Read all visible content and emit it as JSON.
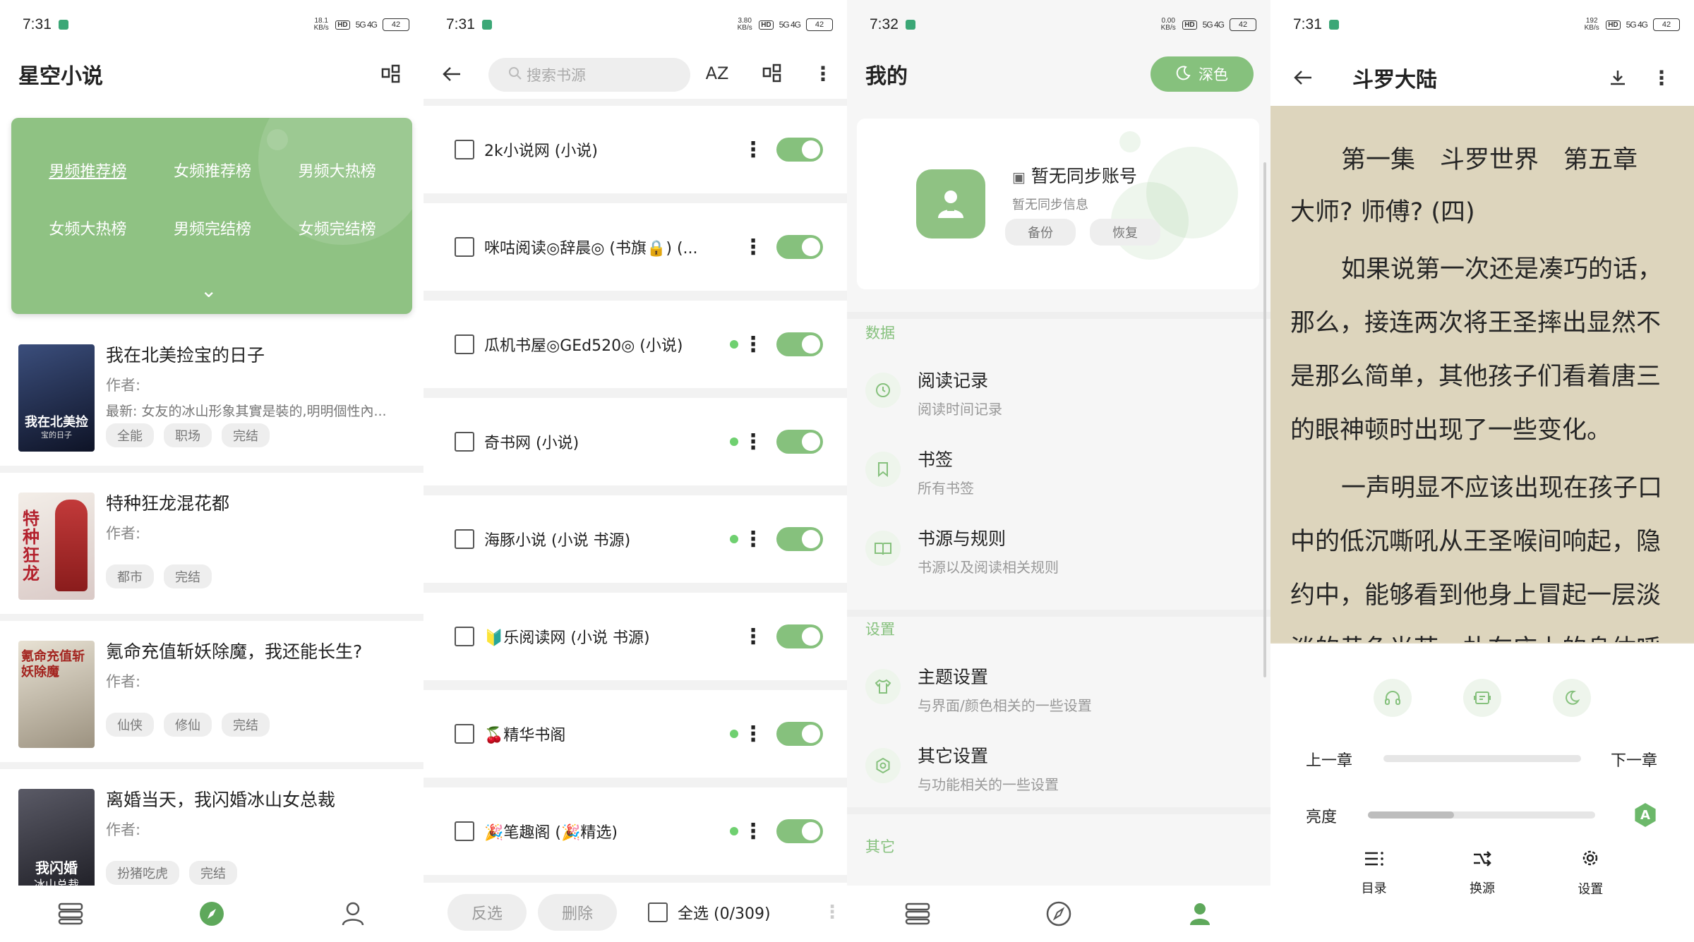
{
  "status_panel1": {
    "time": "7:31",
    "rate_top": "18.1",
    "rate_unit": "KB/s",
    "hd": "HD",
    "net": "5G 4G",
    "battery": "42"
  },
  "status_panel2": {
    "time": "7:31",
    "rate_top": "3.80",
    "rate_unit": "KB/s",
    "hd": "HD",
    "net": "5G 4G",
    "battery": "42"
  },
  "status_panel3": {
    "time": "7:32",
    "rate_top": "0.00",
    "rate_unit": "KB/s",
    "hd": "HD",
    "net": "5G 4G",
    "battery": "42"
  },
  "status_panel4": {
    "time": "7:31",
    "rate_top": "192",
    "rate_unit": "KB/s",
    "hd": "HD",
    "net": "5G 4G",
    "battery": "42"
  },
  "discover": {
    "title": "星空小说",
    "rank_tabs": [
      "男频推荐榜",
      "女频推荐榜",
      "男频大热榜",
      "女频大热榜",
      "男频完结榜",
      "女频完结榜"
    ],
    "books": [
      {
        "title": "我在北美捡宝的日子",
        "author": "作者:",
        "latest": "最新: 女友的冰山形象其實是裝的,明明個性內...",
        "tags": [
          "全能",
          "职场",
          "完结"
        ],
        "cover_text": "我在北美捡",
        "cover_sub": "宝的日子",
        "cover_color": "#1d2a4a"
      },
      {
        "title": "特种狂龙混花都",
        "author": "作者:",
        "latest": "",
        "tags": [
          "都市",
          "完结"
        ],
        "cover_text": "特种狂龙",
        "cover_sub": "",
        "cover_color": "#e9e3e0"
      },
      {
        "title": "氪命充值斩妖除魔，我还能长生?",
        "author": "作者:",
        "latest": "",
        "tags": [
          "仙侠",
          "修仙",
          "完结"
        ],
        "cover_text": "氪命充值斩妖除魔",
        "cover_sub": "",
        "cover_color": "#d8d2c4"
      },
      {
        "title": "离婚当天，我闪婚冰山女总裁",
        "author": "作者:",
        "latest": "",
        "tags": [
          "扮猪吃虎",
          "完结"
        ],
        "cover_text": "我闪婚",
        "cover_sub": "冰山总裁",
        "cover_color": "#3a3a44"
      }
    ]
  },
  "sources": {
    "search_placeholder": "搜索书源",
    "az": "AZ",
    "items": [
      {
        "name": "2k小说网 (小说)",
        "dot": false
      },
      {
        "name": "咪咕阅读◎辞晨◎ (书旗🔒) (...",
        "dot": false
      },
      {
        "name": "瓜机书屋◎GEd520◎ (小说)",
        "dot": true
      },
      {
        "name": "奇书网 (小说)",
        "dot": true
      },
      {
        "name": "海豚小说 (小说 书源)",
        "dot": true
      },
      {
        "name": "🔰乐阅读网 (小说 书源)",
        "dot": false
      },
      {
        "name": "🍒精华书阁",
        "dot": true
      },
      {
        "name": "🎉笔趣阁 (🎉精选)",
        "dot": true
      }
    ],
    "invert_label": "反选",
    "delete_label": "删除",
    "select_all_label": "全选 (0/309)"
  },
  "mine": {
    "title": "我的",
    "dark_label": "深色",
    "account_name": "暂无同步账号",
    "account_sub": "暂无同步信息",
    "backup_label": "备份",
    "restore_label": "恢复",
    "section_data": "数据",
    "section_settings": "设置",
    "section_other": "其它",
    "items": [
      {
        "title": "阅读记录",
        "sub": "阅读时间记录"
      },
      {
        "title": "书签",
        "sub": "所有书签"
      },
      {
        "title": "书源与规则",
        "sub": "书源以及阅读相关规则"
      },
      {
        "title": "主题设置",
        "sub": "与界面/颜色相关的一些设置"
      },
      {
        "title": "其它设置",
        "sub": "与功能相关的一些设置"
      }
    ]
  },
  "reader": {
    "title": "斗罗大陆",
    "chapter": "第一集　斗罗世界　第五章　大师? 师傅? (四)",
    "para1": "如果说第一次还是凑巧的话，那么，接连两次将王圣摔出显然不是那么简单，其他孩子们看着唐三的眼神顿时出现了一些变化。",
    "para2": "一声明显不应该出现在孩子口中的低沉嘶吼从王圣喉间响起，隐约中，能够看到他身上冒起一层淡淡的黄色光芒，扑在床上的身体呼",
    "prev_chapter": "上一章",
    "next_chapter": "下一章",
    "brightness": "亮度",
    "auto_brightness": "A",
    "brightness_level": 0.38,
    "toc_label": "目录",
    "change_source_label": "换源",
    "settings_label": "设置"
  },
  "colors": {
    "accent": "#86c17d",
    "accent_dark": "#5ea85b",
    "paper": "#ddd5bd"
  }
}
